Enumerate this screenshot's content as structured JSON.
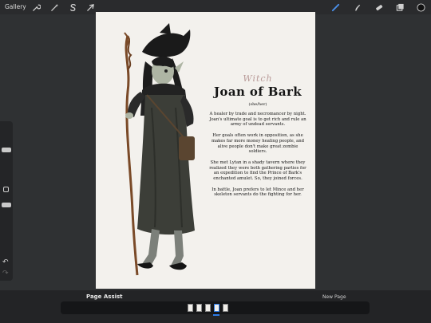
{
  "toolbar": {
    "gallery_label": "Gallery",
    "left_tools": [
      "wrench-icon",
      "wand-icon",
      "s-selection-icon",
      "arrow-icon"
    ],
    "right_tools": [
      "brush-icon",
      "smudge-icon",
      "eraser-icon",
      "layers-icon",
      "color-icon"
    ],
    "active_color": "#111111",
    "brush_color": "#4a8fe8"
  },
  "page": {
    "subtitle": "Witch",
    "title": "Joan of Bark",
    "pronouns": "(she/her)",
    "paragraphs": [
      "A healer by trade and necromancer by night. Joan's ultimate goal is to get rich and rule an army of undead servants.",
      "Her goals often work in opposition, as she makes far more money healing people, and alive people don't make great zombie soldiers.",
      "She met Lytan in a shady tavern where they realized they were both gathering parties for an expedition to find the Prince of Bark's enchanted amulet. So, they joined forces.",
      "In battle, Joan prefers to let Mince and her skeleton servants do the fighting for her."
    ]
  },
  "page_assist": {
    "title": "Page Assist",
    "new_page_label": "New Page",
    "pages": [
      "1",
      "2",
      "3",
      "4",
      "5"
    ],
    "selected_page": "4"
  }
}
